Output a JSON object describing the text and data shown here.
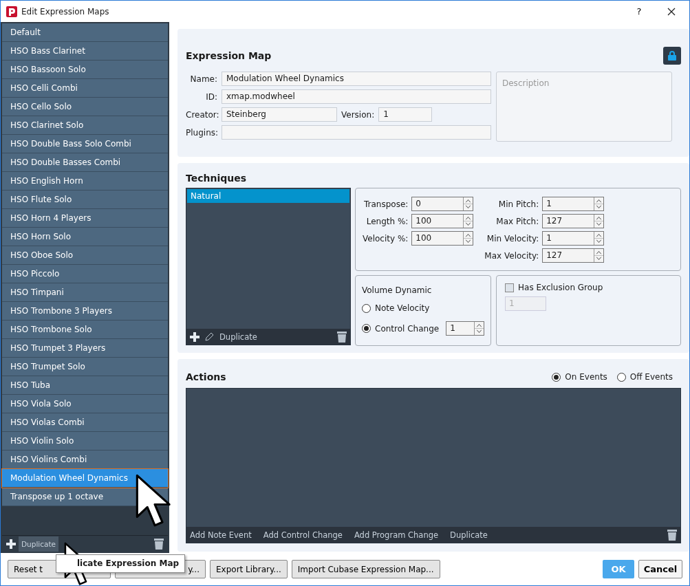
{
  "window": {
    "title": "Edit Expression Maps",
    "help": "?"
  },
  "maps": {
    "items": [
      {
        "label": "Default",
        "selected": false
      },
      {
        "label": "HSO Bass Clarinet",
        "selected": false
      },
      {
        "label": "HSO Bassoon Solo",
        "selected": false
      },
      {
        "label": "HSO Celli Combi",
        "selected": false
      },
      {
        "label": "HSO Cello Solo",
        "selected": false
      },
      {
        "label": "HSO Clarinet Solo",
        "selected": false
      },
      {
        "label": "HSO Double Bass Solo Combi",
        "selected": false
      },
      {
        "label": "HSO Double Basses Combi",
        "selected": false
      },
      {
        "label": "HSO English Horn",
        "selected": false
      },
      {
        "label": "HSO Flute Solo",
        "selected": false
      },
      {
        "label": "HSO Horn 4 Players",
        "selected": false
      },
      {
        "label": "HSO Horn Solo",
        "selected": false
      },
      {
        "label": "HSO Oboe Solo",
        "selected": false
      },
      {
        "label": "HSO Piccolo",
        "selected": false
      },
      {
        "label": "HSO Timpani",
        "selected": false
      },
      {
        "label": "HSO Trombone 3 Players",
        "selected": false
      },
      {
        "label": "HSO Trombone Solo",
        "selected": false
      },
      {
        "label": "HSO Trumpet 3 Players",
        "selected": false
      },
      {
        "label": "HSO Trumpet Solo",
        "selected": false
      },
      {
        "label": "HSO Tuba",
        "selected": false
      },
      {
        "label": "HSO Viola Solo",
        "selected": false
      },
      {
        "label": "HSO Violas Combi",
        "selected": false
      },
      {
        "label": "HSO Violin Solo",
        "selected": false
      },
      {
        "label": "HSO Violins Combi",
        "selected": false
      },
      {
        "label": "Modulation Wheel Dynamics",
        "selected": true
      },
      {
        "label": "Transpose up 1 octave",
        "selected": false
      }
    ],
    "duplicate": "Duplicate"
  },
  "tooltip": "licate Expression Map",
  "expression_map": {
    "title": "Expression Map",
    "locked": true,
    "name": {
      "label": "Name:",
      "value": "Modulation Wheel Dynamics"
    },
    "id": {
      "label": "ID:",
      "value": "xmap.modwheel"
    },
    "creator": {
      "label": "Creator:",
      "value": "Steinberg"
    },
    "version": {
      "label": "Version:",
      "value": "1"
    },
    "plugins": {
      "label": "Plugins:"
    },
    "description": {
      "placeholder": "Description"
    }
  },
  "techniques": {
    "title": "Techniques",
    "items": [
      {
        "label": "Natural",
        "selected": true
      }
    ],
    "duplicate": "Duplicate",
    "params_left": [
      {
        "label": "Transpose:",
        "value": "0"
      },
      {
        "label": "Length %:",
        "value": "100"
      },
      {
        "label": "Velocity %:",
        "value": "100"
      }
    ],
    "params_right": [
      {
        "label": "Min Pitch:",
        "value": "1"
      },
      {
        "label": "Max Pitch:",
        "value": "127"
      },
      {
        "label": "Min Velocity:",
        "value": "1"
      },
      {
        "label": "Max Velocity:",
        "value": "127"
      }
    ],
    "volume_dynamic": {
      "title": "Volume Dynamic",
      "options": [
        {
          "label": "Note Velocity",
          "selected": false
        },
        {
          "label": "Control Change",
          "selected": true
        }
      ],
      "control_change": "1"
    },
    "exclusion": {
      "label": "Has Exclusion Group",
      "checked": false,
      "value": "1",
      "disabled": true
    }
  },
  "actions": {
    "title": "Actions",
    "modes": [
      {
        "label": "On Events",
        "selected": true
      },
      {
        "label": "Off Events",
        "selected": false
      }
    ],
    "footer": [
      "Add Note Event",
      "Add Control Change",
      "Add Program Change",
      "Duplicate"
    ]
  },
  "buttons": [
    "Reset t",
    "y...",
    "Export Library...",
    "Import Cubase Expression Map..."
  ],
  "ok": "OK",
  "cancel": "Cancel"
}
